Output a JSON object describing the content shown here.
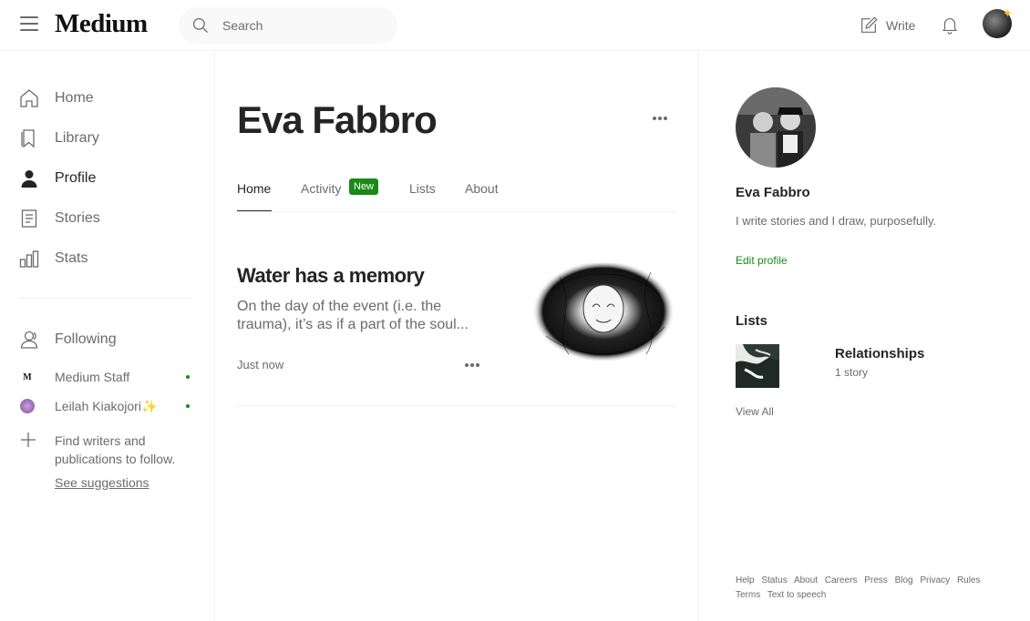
{
  "header": {
    "logo": "Medium",
    "search_placeholder": "Search",
    "write_label": "Write"
  },
  "sidebar": {
    "nav": [
      {
        "label": "Home",
        "icon": "home-icon"
      },
      {
        "label": "Library",
        "icon": "bookmark-icon"
      },
      {
        "label": "Profile",
        "icon": "person-icon",
        "active": true
      },
      {
        "label": "Stories",
        "icon": "document-icon"
      },
      {
        "label": "Stats",
        "icon": "bar-chart-icon"
      }
    ],
    "following_label": "Following",
    "following": [
      {
        "name": "Medium Staff",
        "avatar": "M"
      },
      {
        "name": "Leilah Kiakojori✨",
        "avatar": ""
      }
    ],
    "find_text": "Find writers and publications to follow.",
    "see_suggestions": "See suggestions"
  },
  "profile": {
    "name": "Eva Fabbro",
    "tabs": [
      "Home",
      "Activity",
      "Lists",
      "About"
    ],
    "new_badge": "New"
  },
  "article": {
    "title": "Water has a memory",
    "subtitle": "On the day of the event (i.e. the trauma), it’s as if a part of the soul...",
    "date": "Just now"
  },
  "right": {
    "name": "Eva Fabbro",
    "bio": "I write stories and I draw, purposefully.",
    "edit_profile": "Edit profile",
    "lists_heading": "Lists",
    "list_title": "Relationships",
    "list_count": "1 story",
    "view_all": "View All"
  },
  "footer": {
    "links": [
      "Help",
      "Status",
      "About",
      "Careers",
      "Press",
      "Blog",
      "Privacy",
      "Rules",
      "Terms",
      "Text to speech"
    ]
  },
  "colors": {
    "accent_green": "#1a8917",
    "text_primary": "#242424",
    "text_secondary": "#6b6b6b"
  }
}
